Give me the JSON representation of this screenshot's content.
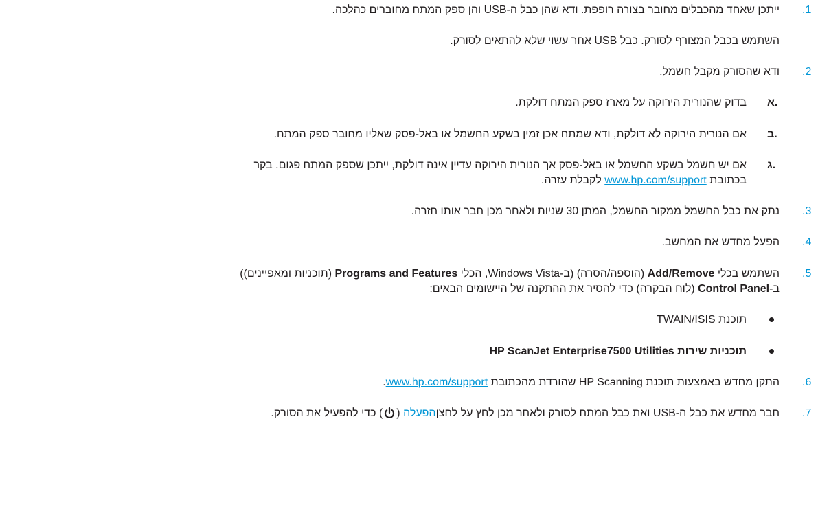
{
  "steps": {
    "s1": {
      "num": ".1",
      "text": "ייתכן שאחד מהכבלים מחובר בצורה רופפת. ודא שהן כבל ה-USB והן ספק המתח מחוברים כהלכה.",
      "note": "השתמש בכבל המצורף לסורק. כבל USB אחר עשוי שלא להתאים לסורק."
    },
    "s2": {
      "num": ".2",
      "text": "ודא שהסורק מקבל חשמל.",
      "sub": {
        "a": {
          "letter": "א.",
          "text": "בדוק שהנורית הירוקה על מארז ספק המתח דולקת."
        },
        "b": {
          "letter": "ב.",
          "text": "אם הנורית הירוקה לא דולקת, ודא שמתח אכן זמין בשקע החשמל או באל-פסק שאליו מחובר ספק המתח."
        },
        "c": {
          "letter": "ג.",
          "line1": "אם יש חשמל בשקע החשמל או באל-פסק אך הנורית הירוקה עדיין אינה דולקת, ייתכן שספק המתח פגום. בקר",
          "line2_pre": "בכתובת ",
          "link": "www.hp.com/support",
          "line2_post": " לקבלת עזרה."
        }
      }
    },
    "s3": {
      "num": ".3",
      "text": "נתק את כבל החשמל ממקור החשמל, המתן 30 שניות ולאחר מכן חבר אותו חזרה."
    },
    "s4": {
      "num": ".4",
      "text": "הפעל מחדש את המחשב."
    },
    "s5": {
      "num": ".5",
      "p1": "השתמש בכלי ",
      "addremove": "Add/Remove",
      "p2": " (הוספה/הסרה) (ב-Windows Vista, הכלי ",
      "programs": "Programs and Features",
      "p3": " (תוכניות ומאפיינים))",
      "l2a": "ב-",
      "controlpanel": "Control Panel",
      "l2b": " (לוח הבקרה) כדי להסיר את ההתקנה של היישומים הבאים:",
      "bullets": [
        "תוכנת TWAIN/ISIS",
        "תוכניות שירות HP ScanJet Enterprise7500 Utilities"
      ]
    },
    "s6": {
      "num": ".6",
      "pre": "התקן מחדש באמצעות תוכנת HP Scanning שהורדת מהכתובת ",
      "link": "www.hp.com/support",
      "post": "."
    },
    "s7": {
      "num": ".7",
      "pre": "חבר מחדש את כבל ה-USB ואת כבל המתח לסורק ולאחר מכן לחץ על לחצן",
      "button": "הפעלה",
      "post": " כדי להפעיל את הסורק.",
      "icon": "power-icon"
    }
  },
  "colors": {
    "accent": "#0096d6",
    "text": "#231f20"
  }
}
